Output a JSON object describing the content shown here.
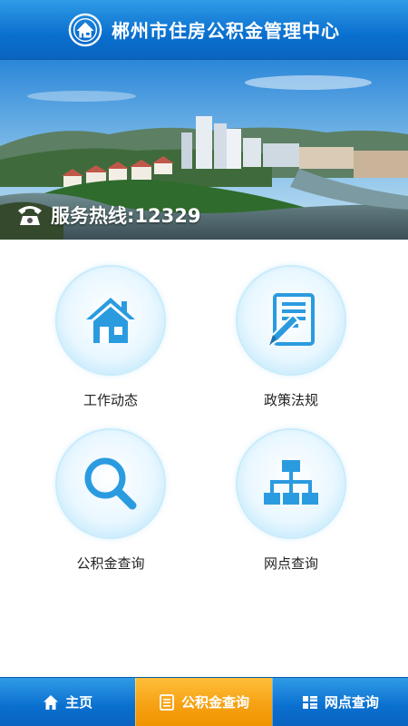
{
  "header": {
    "title": "郴州市住房公积金管理中心",
    "logo_icon": "house-shield-logo-icon"
  },
  "banner": {
    "hotline_text": "服务热线:12329",
    "phone_icon": "phone-icon"
  },
  "menu": [
    {
      "label": "工作动态",
      "icon": "house-icon"
    },
    {
      "label": "政策法规",
      "icon": "document-pen-icon"
    },
    {
      "label": "公积金查询",
      "icon": "search-icon"
    },
    {
      "label": "网点查询",
      "icon": "org-chart-icon"
    }
  ],
  "nav": [
    {
      "label": "主页",
      "icon": "home-icon",
      "active": false
    },
    {
      "label": "公积金查询",
      "icon": "list-icon",
      "active": true
    },
    {
      "label": "网点查询",
      "icon": "grid-list-icon",
      "active": false
    }
  ],
  "colors": {
    "primary": "#0a6fcf",
    "accent": "#f6a214",
    "icon_blue": "#2b9be0"
  }
}
